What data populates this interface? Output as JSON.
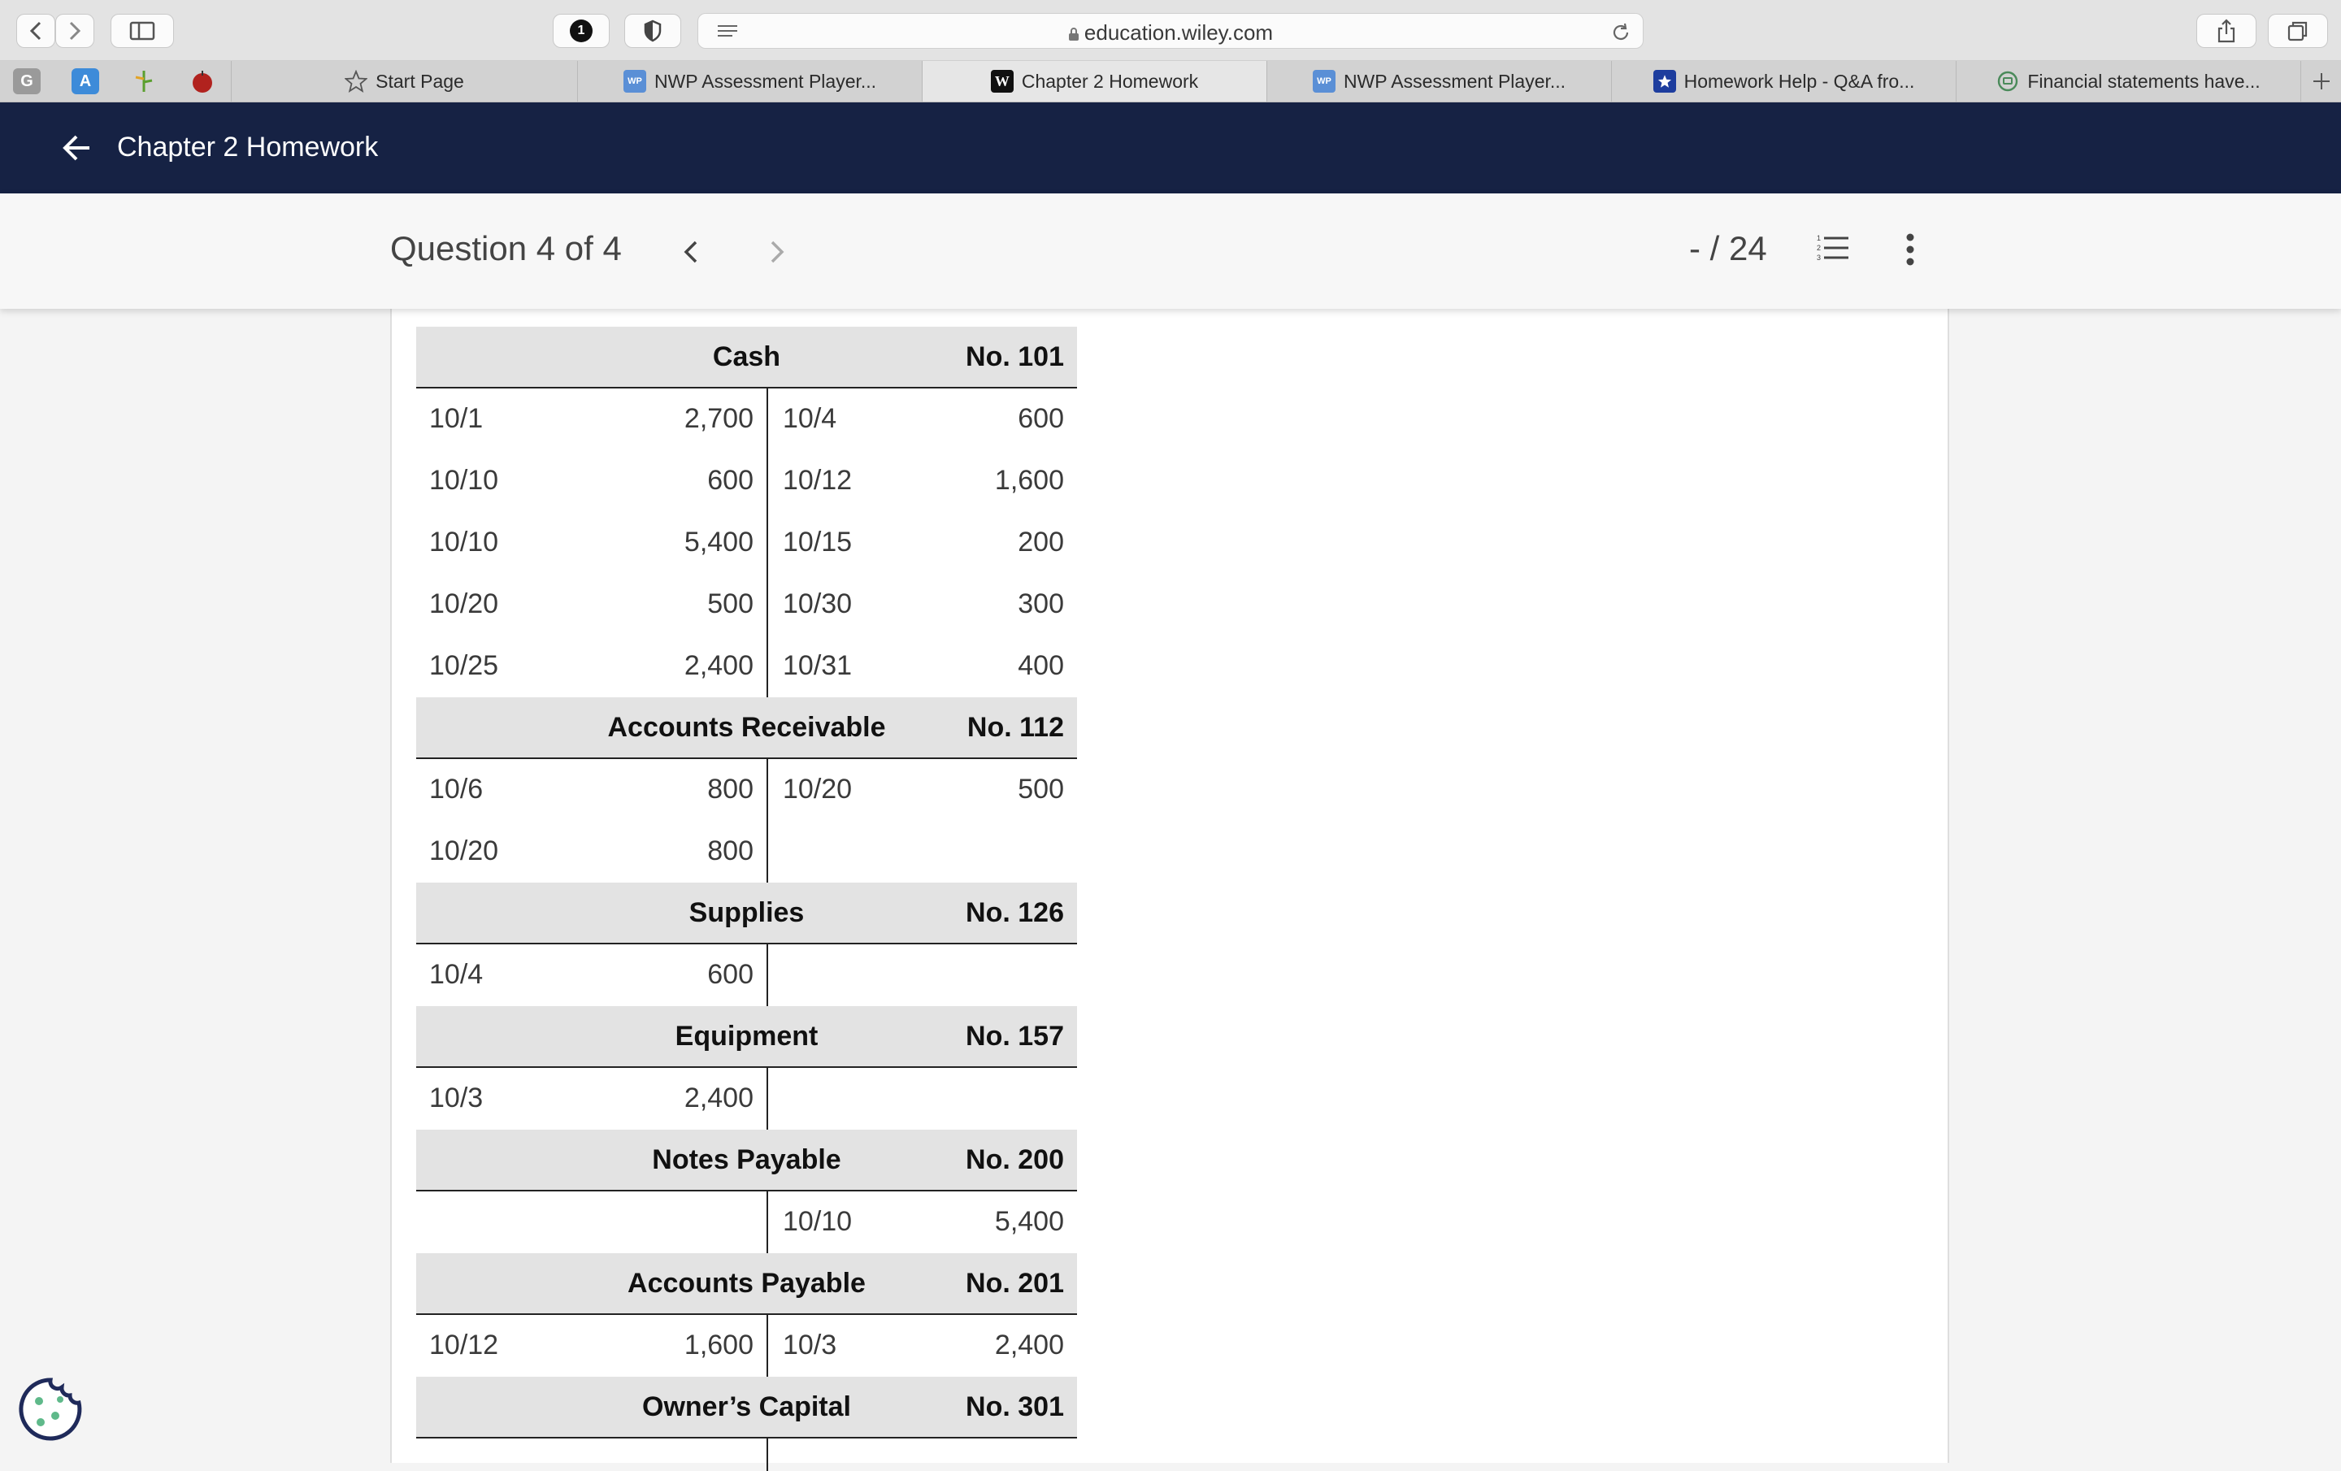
{
  "browser": {
    "url": "education.wiley.com",
    "badge_count": "1",
    "tabs": [
      {
        "label": "Start Page",
        "icon": "star-icon"
      },
      {
        "label": "NWP Assessment Player...",
        "icon": "wp-icon"
      },
      {
        "label": "Chapter 2 Homework",
        "icon": "wiley-icon"
      },
      {
        "label": "NWP Assessment Player...",
        "icon": "wp-icon"
      },
      {
        "label": "Homework Help - Q&A fro...",
        "icon": "chegg-star-icon"
      },
      {
        "label": "Financial statements have...",
        "icon": "chat-icon"
      }
    ],
    "favorites": [
      "G",
      "A",
      "",
      ""
    ]
  },
  "header": {
    "title": "Chapter 2 Homework"
  },
  "question_bar": {
    "title": "Question 4 of 4",
    "score": "- / 24"
  },
  "accounts": [
    {
      "name": "Cash",
      "number": "No. 101",
      "rows": [
        [
          "10/1",
          "2,700",
          "10/4",
          "600"
        ],
        [
          "10/10",
          "600",
          "10/12",
          "1,600"
        ],
        [
          "10/10",
          "5,400",
          "10/15",
          "200"
        ],
        [
          "10/20",
          "500",
          "10/30",
          "300"
        ],
        [
          "10/25",
          "2,400",
          "10/31",
          "400"
        ]
      ]
    },
    {
      "name": "Accounts Receivable",
      "number": "No. 112",
      "rows": [
        [
          "10/6",
          "800",
          "10/20",
          "500"
        ],
        [
          "10/20",
          "800",
          "",
          ""
        ]
      ]
    },
    {
      "name": "Supplies",
      "number": "No. 126",
      "rows": [
        [
          "10/4",
          "600",
          "",
          ""
        ]
      ]
    },
    {
      "name": "Equipment",
      "number": "No. 157",
      "rows": [
        [
          "10/3",
          "2,400",
          "",
          ""
        ]
      ]
    },
    {
      "name": "Notes Payable",
      "number": "No. 200",
      "rows": [
        [
          "",
          "",
          "10/10",
          "5,400"
        ]
      ]
    },
    {
      "name": "Accounts Payable",
      "number": "No. 201",
      "rows": [
        [
          "10/12",
          "1,600",
          "10/3",
          "2,400"
        ]
      ]
    },
    {
      "name": "Owner’s Capital",
      "number": "No. 301",
      "rows": []
    }
  ],
  "colors": {
    "header_bg": "#162244",
    "panel_bg": "#ffffff",
    "account_head_bg": "#e3e3e3"
  }
}
